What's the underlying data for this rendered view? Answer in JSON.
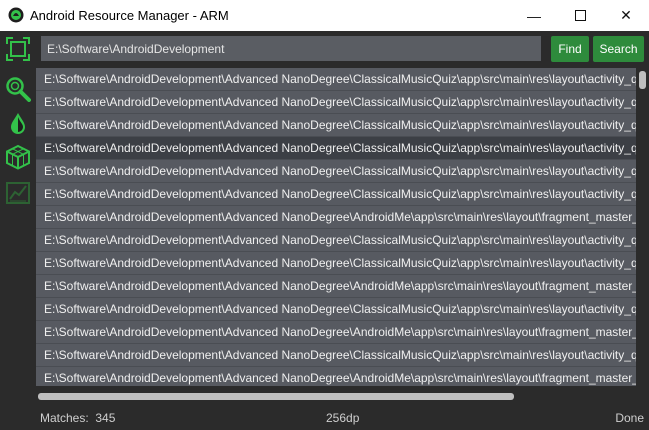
{
  "window": {
    "title": "Android Resource Manager - ARM"
  },
  "search": {
    "path_value": "E:\\Software\\AndroidDevelopment",
    "find_label": "Find",
    "search_label": "Search"
  },
  "results": [
    "E:\\Software\\AndroidDevelopment\\Advanced NanoDegree\\ClassicalMusicQuiz\\app\\src\\main\\res\\layout\\activity_quiz.xml",
    "E:\\Software\\AndroidDevelopment\\Advanced NanoDegree\\ClassicalMusicQuiz\\app\\src\\main\\res\\layout\\activity_quiz.xml",
    "E:\\Software\\AndroidDevelopment\\Advanced NanoDegree\\ClassicalMusicQuiz\\app\\src\\main\\res\\layout\\activity_quiz.xml",
    "E:\\Software\\AndroidDevelopment\\Advanced NanoDegree\\ClassicalMusicQuiz\\app\\src\\main\\res\\layout\\activity_quiz.xml",
    "E:\\Software\\AndroidDevelopment\\Advanced NanoDegree\\ClassicalMusicQuiz\\app\\src\\main\\res\\layout\\activity_quiz.xml",
    "E:\\Software\\AndroidDevelopment\\Advanced NanoDegree\\ClassicalMusicQuiz\\app\\src\\main\\res\\layout\\activity_quiz.xml",
    "E:\\Software\\AndroidDevelopment\\Advanced NanoDegree\\AndroidMe\\app\\src\\main\\res\\layout\\fragment_master_list.xml",
    "E:\\Software\\AndroidDevelopment\\Advanced NanoDegree\\ClassicalMusicQuiz\\app\\src\\main\\res\\layout\\activity_quiz.xml",
    "E:\\Software\\AndroidDevelopment\\Advanced NanoDegree\\ClassicalMusicQuiz\\app\\src\\main\\res\\layout\\activity_quiz.xml",
    "E:\\Software\\AndroidDevelopment\\Advanced NanoDegree\\AndroidMe\\app\\src\\main\\res\\layout\\fragment_master_list.xml",
    "E:\\Software\\AndroidDevelopment\\Advanced NanoDegree\\ClassicalMusicQuiz\\app\\src\\main\\res\\layout\\activity_quiz.xml",
    "E:\\Software\\AndroidDevelopment\\Advanced NanoDegree\\AndroidMe\\app\\src\\main\\res\\layout\\fragment_master_list.xml",
    "E:\\Software\\AndroidDevelopment\\Advanced NanoDegree\\ClassicalMusicQuiz\\app\\src\\main\\res\\layout\\activity_quiz.xml",
    "E:\\Software\\AndroidDevelopment\\Advanced NanoDegree\\AndroidMe\\app\\src\\main\\res\\layout\\fragment_master_list.xml"
  ],
  "selected_row": 3,
  "status": {
    "matches_label": "Matches:",
    "matches_count": "345",
    "dp_value": "256dp",
    "state": "Done"
  },
  "colors": {
    "accent": "#2e8b3c",
    "icon_green": "#33c24a",
    "background": "#2b2b2b",
    "list_bg": "#575a61",
    "selected_bg": "#3c3f45"
  },
  "icons": [
    "app-logo-icon",
    "select-area-icon",
    "magnifier-icon",
    "color-drop-icon",
    "cube-icon",
    "chart-icon"
  ]
}
